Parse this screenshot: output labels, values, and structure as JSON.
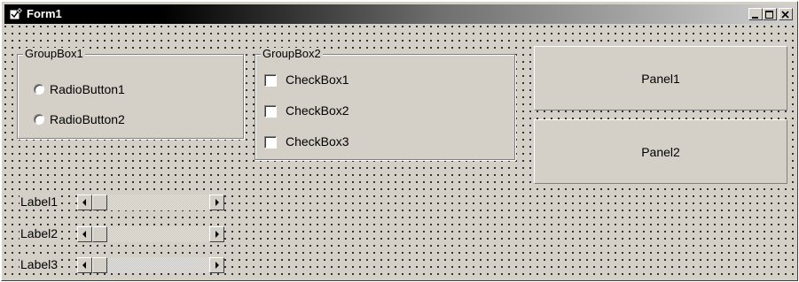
{
  "window": {
    "title": "Form1",
    "icons": {
      "app": "delphi-form-icon",
      "minimize": "minimize-icon",
      "maximize": "maximize-icon",
      "close": "close-icon"
    }
  },
  "groupbox1": {
    "caption": "GroupBox1",
    "radios": [
      {
        "label": "RadioButton1",
        "checked": false
      },
      {
        "label": "RadioButton2",
        "checked": false
      }
    ]
  },
  "groupbox2": {
    "caption": "GroupBox2",
    "checkboxes": [
      {
        "label": "CheckBox1",
        "checked": false
      },
      {
        "label": "CheckBox2",
        "checked": false
      },
      {
        "label": "CheckBox3",
        "checked": false
      }
    ]
  },
  "panels": [
    {
      "caption": "Panel1"
    },
    {
      "caption": "Panel2"
    }
  ],
  "rows": [
    {
      "label": "Label1",
      "position": 0
    },
    {
      "label": "Label2",
      "position": 0
    },
    {
      "label": "Label3",
      "position": 0
    }
  ],
  "colors": {
    "face": "#d4d0c8",
    "title_start": "#000000",
    "title_end": "#d0d0d0",
    "grid_dot": "#000000"
  }
}
